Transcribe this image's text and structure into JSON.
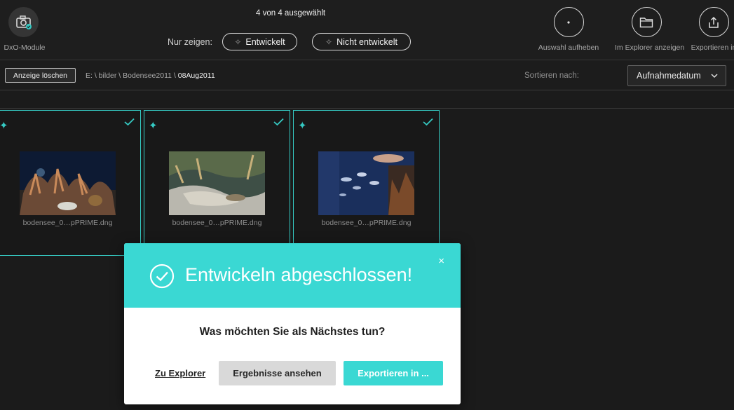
{
  "topbar": {
    "module_label": "DxO-Module",
    "selection_count": "4 von 4 ausgewählt",
    "filter_label": "Nur zeigen:",
    "filter_developed": "Entwickelt",
    "filter_not_developed": "Nicht entwickelt",
    "actions": {
      "deselect": "Auswahl aufheben",
      "show_in_explorer": "Im Explorer anzeigen",
      "export": "Exportieren in"
    }
  },
  "pathbar": {
    "clear_button": "Anzeige löschen",
    "breadcrumb_path": "E: \\ bilder \\ Bodensee2011 \\ ",
    "breadcrumb_current": "08Aug2011",
    "sort_label": "Sortieren nach:",
    "sort_value": "Aufnahmedatum"
  },
  "thumbnails": [
    {
      "filename": "bodensee_0…pPRIME.dng",
      "developed": true,
      "selected": true
    },
    {
      "filename": "bodensee_0…pPRIME.dng",
      "developed": true,
      "selected": true
    },
    {
      "filename": "bodensee_0…pPRIME.dng",
      "developed": true,
      "selected": true
    }
  ],
  "dialog": {
    "title": "Entwickeln abgeschlossen!",
    "close_glyph": "×",
    "question": "Was möchten Sie als Nächstes tun?",
    "link_explorer": "Zu Explorer",
    "button_results": "Ergebnisse ansehen",
    "button_export": "Exportieren in ..."
  },
  "colors": {
    "accent": "#3ad8d3",
    "thumb_border": "#35c9c2",
    "background": "#1b1b1b"
  },
  "icons": [
    "camera-module-icon",
    "dot-icon",
    "folder-icon",
    "upload-icon",
    "sparkle-icon",
    "check-icon",
    "chevron-down-icon",
    "check-circle-icon",
    "close-icon"
  ]
}
